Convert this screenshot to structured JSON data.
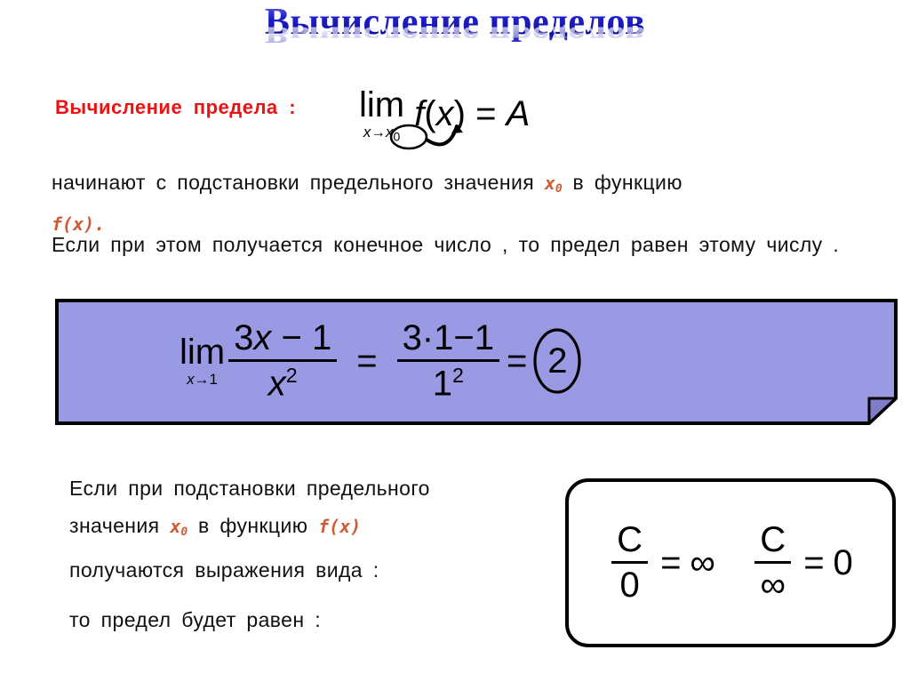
{
  "slide": {
    "title": "Вычисление пределов",
    "title_color": "#2020cc",
    "accent_color": "#cf5b35",
    "label_color": "#ee1111",
    "box_fill": "#9a9ae4",
    "box_border": "#000000"
  },
  "calc_label": {
    "text": "Вычисление  предела :"
  },
  "limit_formula": {
    "lim": "lim",
    "subscript_var": "x",
    "subscript_arrow": "→",
    "subscript_target": "x",
    "subscript_target_index": "0",
    "function": "f",
    "open_paren": "(",
    "arg": "x",
    "close_paren": ")",
    "equals": "=",
    "result": "A"
  },
  "paragraphs": {
    "p1": {
      "part1": "начинают  с  подстановки  предельного  значения ",
      "accent1": "x",
      "accent1_sub": "0",
      "part2": " в  функцию",
      "accent2": "f(x)."
    },
    "p2": {
      "text": "Если  при  этом  получается  конечное  число ,  то  предел  равен  этому  числу ."
    },
    "p3": {
      "line1": "Если  при  подстановки  предельного",
      "line2_part1": "значения ",
      "line2_accent1": "x",
      "line2_accent1_sub": "0",
      "line2_part2": " в  функцию ",
      "line2_accent2": "f(x)",
      "line3": "получаются  выражения  вида :"
    },
    "p4": {
      "text": "то  предел  будет  равен :"
    }
  },
  "example": {
    "lim": "lim",
    "sub_var": "x",
    "sub_arrow": "→",
    "sub_value": "1",
    "numerator_coef": "3",
    "numerator_var": "x",
    "numerator_minus": "−",
    "numerator_const": "1",
    "denominator_var": "x",
    "denominator_exp": "2",
    "equals1": "=",
    "rhs_num": "3·1−1",
    "rhs_den": "1",
    "rhs_den_exp": "2",
    "equals2": "=",
    "answer": "2"
  },
  "cases": {
    "case1": {
      "numerator": "C",
      "denominator": "0",
      "equals": "=",
      "result": "∞"
    },
    "case2": {
      "numerator": "C",
      "denominator": "∞",
      "equals": "=",
      "result": "0"
    }
  }
}
